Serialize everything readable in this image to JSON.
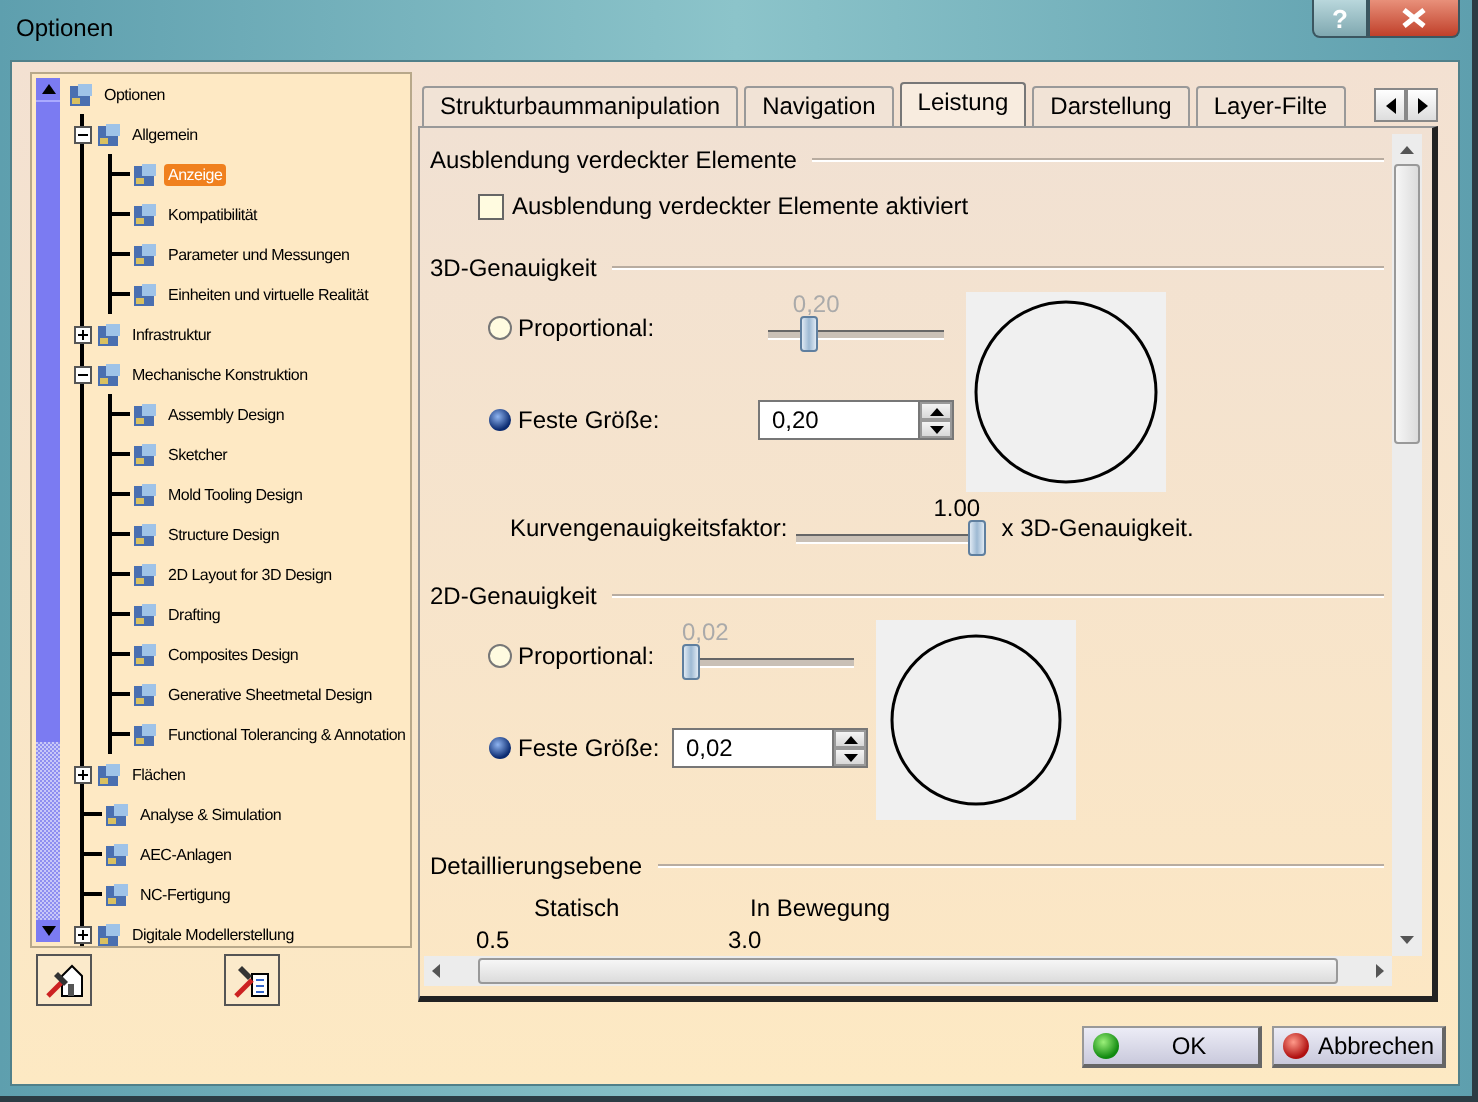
{
  "window": {
    "title": "Optionen",
    "help_button": "?"
  },
  "tree": {
    "items": [
      {
        "label": "Optionen",
        "selected": false,
        "children": [
          {
            "label": "Allgemein",
            "selected": false,
            "expanded": true,
            "children": [
              {
                "label": "Anzeige",
                "selected": true
              },
              {
                "label": "Kompatibilität",
                "selected": false
              },
              {
                "label": "Parameter und Messungen",
                "selected": false
              },
              {
                "label": "Einheiten und virtuelle Realität",
                "selected": false
              }
            ]
          },
          {
            "label": "Infrastruktur",
            "selected": false,
            "expanded": false
          },
          {
            "label": "Mechanische Konstruktion",
            "selected": false,
            "expanded": true,
            "children": [
              {
                "label": "Assembly Design",
                "selected": false
              },
              {
                "label": "Sketcher",
                "selected": false
              },
              {
                "label": "Mold Tooling Design",
                "selected": false
              },
              {
                "label": "Structure Design",
                "selected": false
              },
              {
                "label": "2D Layout for 3D Design",
                "selected": false
              },
              {
                "label": "Drafting",
                "selected": false
              },
              {
                "label": "Composites Design",
                "selected": false
              },
              {
                "label": "Generative Sheetmetal Design",
                "selected": false
              },
              {
                "label": "Functional Tolerancing & Annotation",
                "selected": false
              }
            ]
          },
          {
            "label": "Flächen",
            "selected": false,
            "expanded": false
          },
          {
            "label": "Analyse & Simulation",
            "selected": false
          },
          {
            "label": "AEC-Anlagen",
            "selected": false
          },
          {
            "label": "NC-Fertigung",
            "selected": false
          },
          {
            "label": "Digitale Modellerstellung",
            "selected": false,
            "expanded": false
          }
        ]
      }
    ]
  },
  "tabs": [
    {
      "label": "Strukturbaummanipulation",
      "selected": false
    },
    {
      "label": "Navigation",
      "selected": false
    },
    {
      "label": "Leistung",
      "selected": true
    },
    {
      "label": "Darstellung",
      "selected": false
    },
    {
      "label": "Layer-Filte",
      "selected": false
    }
  ],
  "hidden_elements": {
    "title": "Ausblendung verdeckter Elemente",
    "checkbox": {
      "label": "Ausblendung verdeckter Elemente aktiviert",
      "checked": false
    }
  },
  "accuracy_3d": {
    "title": "3D-Genauigkeit",
    "proportional": {
      "label": "Proportional:",
      "selected": false,
      "slider": {
        "value": "0,20",
        "level": 0.2,
        "disabled": true
      }
    },
    "fixed": {
      "label": "Feste Größe:",
      "selected": true,
      "value": "0,20"
    },
    "curve_factor": {
      "label": "Kurvengenauigkeitsfaktor:",
      "slider": {
        "value": "1.00",
        "level": 1,
        "disabled": false
      },
      "suffix": "x 3D-Genauigkeit."
    }
  },
  "accuracy_2d": {
    "title": "2D-Genauigkeit",
    "proportional": {
      "label": "Proportional:",
      "selected": false,
      "slider": {
        "value": "0,02",
        "level": 0,
        "disabled": true
      }
    },
    "fixed": {
      "label": "Feste Größe:",
      "selected": true,
      "value": "0,02"
    }
  },
  "level_of_detail": {
    "title": "Detaillierungsebene",
    "columns": [
      {
        "label": "Statisch",
        "value": "0.5"
      },
      {
        "label": "In Bewegung",
        "value": "3.0"
      }
    ]
  },
  "buttons": [
    {
      "label": "OK",
      "kind": "ok"
    },
    {
      "label": "Abbrechen",
      "kind": "cancel"
    }
  ]
}
